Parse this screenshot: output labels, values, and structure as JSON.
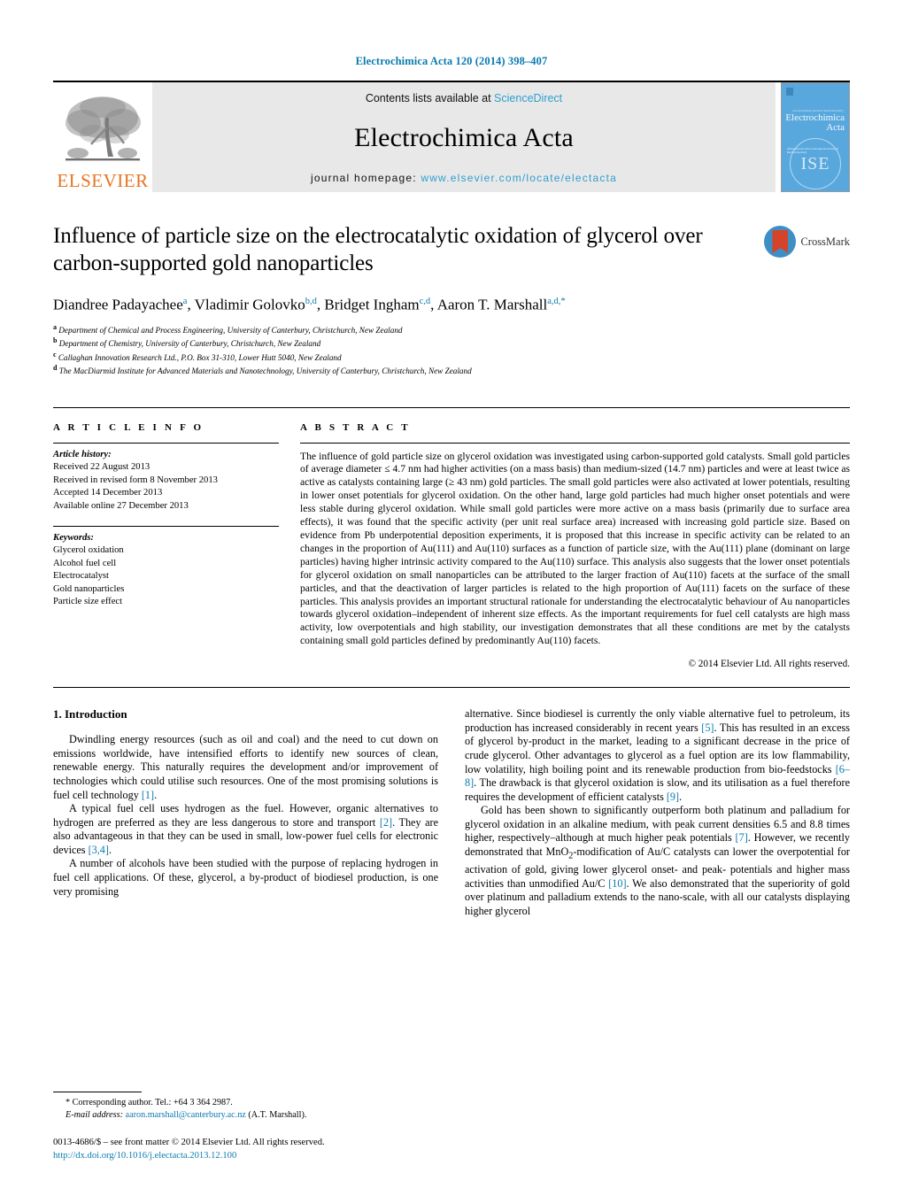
{
  "running_head": "Electrochimica Acta 120 (2014) 398–407",
  "masthead": {
    "publisher": "ELSEVIER",
    "contents_prefix": "Contents lists available at ",
    "sciencedirect": "ScienceDirect",
    "journal_name": "Electrochimica Acta",
    "homepage_prefix": "journal homepage: ",
    "homepage_url": "www.elsevier.com/locate/electacta",
    "cover": {
      "title_line1": "Electrochimica",
      "title_line2": "Acta",
      "micro_line": "an international journal of electrochemistry",
      "sub_line": "official journal of the International Society of Electrochemistry",
      "seal": "ISE"
    }
  },
  "article": {
    "title": "Influence of particle size on the electrocatalytic oxidation of glycerol over carbon-supported gold nanoparticles",
    "crossmark_label": "CrossMark",
    "authors": [
      {
        "name": "Diandree Padayachee",
        "marks": "a",
        "sep": ", "
      },
      {
        "name": "Vladimir Golovko",
        "marks": "b,d",
        "sep": ", "
      },
      {
        "name": "Bridget Ingham",
        "marks": "c,d",
        "sep": ", "
      },
      {
        "name": "Aaron T. Marshall",
        "marks": "a,d,*",
        "sep": ""
      }
    ],
    "affiliations": [
      {
        "marker": "a",
        "text": "Department of Chemical and Process Engineering, University of Canterbury, Christchurch, New Zealand"
      },
      {
        "marker": "b",
        "text": "Department of Chemistry, University of Canterbury, Christchurch, New Zealand"
      },
      {
        "marker": "c",
        "text": "Callaghan Innovation Research Ltd., P.O. Box 31-310, Lower Hutt 5040, New Zealand"
      },
      {
        "marker": "d",
        "text": "The MacDiarmid Institute for Advanced Materials and Nanotechnology, University of Canterbury, Christchurch, New Zealand"
      }
    ]
  },
  "info": {
    "heading": "A R T I C L E    I N F O",
    "history_label": "Article history:",
    "history": [
      "Received 22 August 2013",
      "Received in revised form 8 November 2013",
      "Accepted 14 December 2013",
      "Available online 27 December 2013"
    ],
    "keywords_label": "Keywords:",
    "keywords": [
      "Glycerol oxidation",
      "Alcohol fuel cell",
      "Electrocatalyst",
      "Gold nanoparticles",
      "Particle size effect"
    ]
  },
  "abstract": {
    "heading": "A B S T R A C T",
    "text": "The influence of gold particle size on glycerol oxidation was investigated using carbon-supported gold catalysts. Small gold particles of average diameter ≤ 4.7 nm had higher activities (on a mass basis) than medium-sized (14.7 nm) particles and were at least twice as active as catalysts containing large (≥ 43 nm) gold particles. The small gold particles were also activated at lower potentials, resulting in lower onset potentials for glycerol oxidation. On the other hand, large gold particles had much higher onset potentials and were less stable during glycerol oxidation. While small gold particles were more active on a mass basis (primarily due to surface area effects), it was found that the specific activity (per unit real surface area) increased with increasing gold particle size. Based on evidence from Pb underpotential deposition experiments, it is proposed that this increase in specific activity can be related to an changes in the proportion of Au(111) and Au(110) surfaces as a function of particle size, with the Au(111) plane (dominant on large particles) having higher intrinsic activity compared to the Au(110) surface. This analysis also suggests that the lower onset potentials for glycerol oxidation on small nanoparticles can be attributed to the larger fraction of Au(110) facets at the surface of the small particles, and that the deactivation of larger particles is related to the high proportion of Au(111) facets on the surface of these particles. This analysis provides an important structural rationale for understanding the electrocatalytic behaviour of Au nanoparticles towards glycerol oxidation–independent of inherent size effects. As the important requirements for fuel cell catalysts are high mass activity, low overpotentials and high stability, our investigation demonstrates that all these conditions are met by the catalysts containing small gold particles defined by predominantly Au(110) facets.",
    "copyright": "© 2014 Elsevier Ltd. All rights reserved."
  },
  "body": {
    "section_number_title": "1.  Introduction",
    "left_paragraphs": [
      "Dwindling energy resources (such as oil and coal) and the need to cut down on emissions worldwide, have intensified efforts to identify new sources of clean, renewable energy. This naturally requires the development and/or improvement of technologies which could utilise such resources. One of the most promising solutions is fuel cell technology [1].",
      "A typical fuel cell uses hydrogen as the fuel. However, organic alternatives to hydrogen are preferred as they are less dangerous to store and transport [2]. They are also advantageous in that they can be used in small, low-power fuel cells for electronic devices [3,4].",
      "A number of alcohols have been studied with the purpose of replacing hydrogen in fuel cell applications. Of these, glycerol, a by-product of biodiesel production, is one very promising"
    ],
    "right_paragraphs": [
      "alternative. Since biodiesel is currently the only viable alternative fuel to petroleum, its production has increased considerably in recent years [5]. This has resulted in an excess of glycerol by-product in the market, leading to a significant decrease in the price of crude glycerol. Other advantages to glycerol as a fuel option are its low flammability, low volatility, high boiling point and its renewable production from bio-feedstocks [6–8]. The drawback is that glycerol oxidation is slow, and its utilisation as a fuel therefore requires the development of efficient catalysts [9].",
      "Gold has been shown to significantly outperform both platinum and palladium for glycerol oxidation in an alkaline medium, with peak current densities 6.5 and 8.8 times higher, respectively–although at much higher peak potentials [7]. However, we recently demonstrated that MnO2-modification of Au/C catalysts can lower the overpotential for activation of gold, giving lower glycerol onset- and peak- potentials and higher mass activities than unmodified Au/C [10]. We also demonstrated that the superiority of gold over platinum and palladium extends to the nano-scale, with all our catalysts displaying higher glycerol"
    ]
  },
  "footnote": {
    "corresponding": "* Corresponding author. Tel.: +64 3 364 2987.",
    "email_label": "E-mail address:",
    "email": "aaron.marshall@canterbury.ac.nz",
    "email_suffix": " (A.T. Marshall).",
    "issn_line": "0013-4686/$ – see front matter © 2014 Elsevier Ltd. All rights reserved.",
    "doi": "http://dx.doi.org/10.1016/j.electacta.2013.12.100"
  },
  "colors": {
    "link_blue": "#0a7ab0",
    "sciencedirect_blue": "#2f9fd0",
    "elsevier_orange": "#e87422",
    "cover_blue": "#59a8dd",
    "crossmark_blue": "#3d8fc6",
    "crossmark_red": "#d4442a"
  }
}
